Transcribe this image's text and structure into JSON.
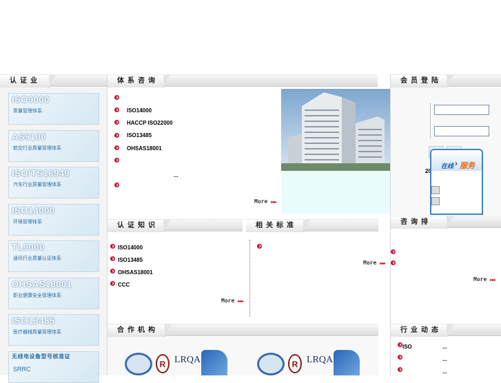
{
  "sections": {
    "cert_business": "认证业务",
    "system_consult": "体系咨询",
    "member_login": "会员登陆",
    "cert_knowledge": "认证知识",
    "related_standards": "相关标准",
    "consult_tab": "咨询排",
    "partners": "合作机构",
    "industry_news": "行业动态"
  },
  "certs": [
    {
      "code": "ISO9000",
      "desc": "质量管理体系"
    },
    {
      "code": "AS9100",
      "desc": "航空行业质量管理体系"
    },
    {
      "code": "ISO/TS16949",
      "desc": "汽车行业质量管理体系"
    },
    {
      "code": "ISO14000",
      "desc": "环境管理体系"
    },
    {
      "code": "TL9000",
      "desc": "通讯行业质量认证体系"
    },
    {
      "code": "OHSAS18001",
      "desc": "职业健康安全管理体系"
    },
    {
      "code": "ISO13485",
      "desc": "医疗器械质量管理体系"
    },
    {
      "code": "无线电设备型号核准证",
      "desc": "SRRC"
    }
  ],
  "consult_items": [
    "",
    "ISO14000",
    "HACCP ISO22000",
    "ISO13485",
    "OHSAS18001",
    "",
    "...",
    ""
  ],
  "knowledge_items": [
    "ISO14000",
    "ISO13485",
    "OHSAS18001",
    "CCC"
  ],
  "news_items": [
    "ISO",
    "",
    ""
  ],
  "news_dots": [
    "...",
    "...",
    "..."
  ],
  "more_label": "More",
  "online_service": {
    "prefix": "在线",
    "label": "服务"
  },
  "login_partial_text": "20",
  "partner_logos": [
    "LRQA",
    "LRQA"
  ],
  "colors": {
    "accent": "#c8102e",
    "bar": "#dcdcdc",
    "photo_sky": "#a9c6e3"
  }
}
